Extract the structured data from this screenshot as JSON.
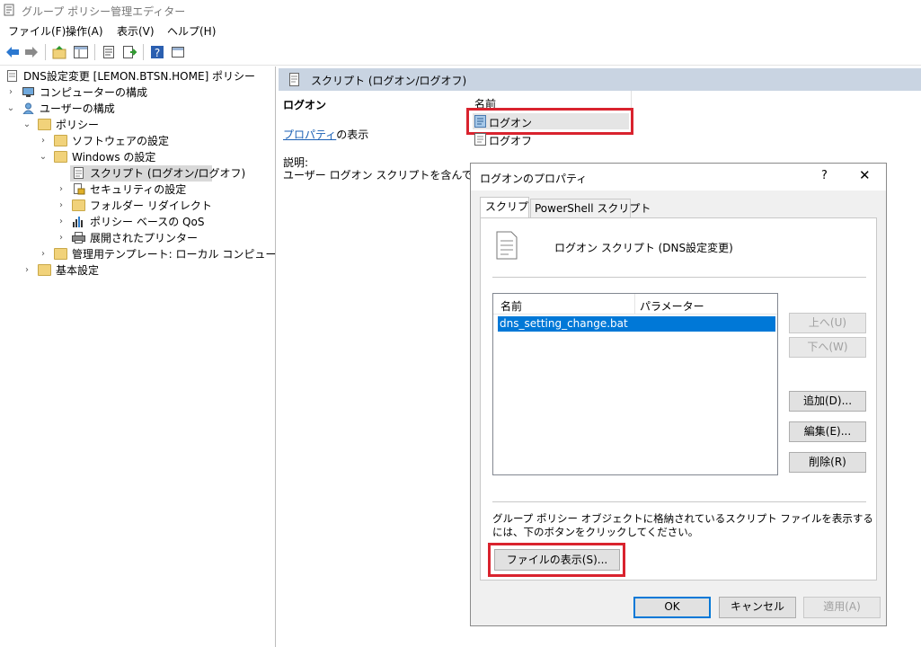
{
  "window": {
    "title": "グループ ポリシー管理エディター"
  },
  "menu": [
    "ファイル(F)",
    "操作(A)",
    "表示(V)",
    "ヘルプ(H)"
  ],
  "toolbar": [
    "back-icon",
    "forward-icon",
    "up-folder-icon",
    "show-hide-tree-icon",
    "properties-icon",
    "export-list-icon",
    "help-icon",
    "console-icon"
  ],
  "tree": {
    "root": "DNS設定変更 [LEMON.BTSN.HOME] ポリシー",
    "items": [
      "コンピューターの構成",
      "ユーザーの構成",
      "ポリシー",
      "ソフトウェアの設定",
      "Windows の設定",
      "スクリプト (ログオン/ログオフ)",
      "セキュリティの設定",
      "フォルダー リダイレクト",
      "ポリシー ベースの QoS",
      "展開されたプリンター",
      "管理用テンプレート: ローカル コンピューターから取",
      "基本設定"
    ]
  },
  "right": {
    "header_title": "スクリプト (ログオン/ログオフ)",
    "section_title": "ログオン",
    "properties_link": "プロパティ",
    "properties_suffix": "の表示",
    "description_label": "説明:",
    "description_text": "ユーザー ログオン スクリプトを含んでいます。",
    "list_header": "名前",
    "list_items": [
      "ログオン",
      "ログオフ"
    ]
  },
  "dialog": {
    "title": "ログオンのプロパティ",
    "help": "?",
    "close": "✕",
    "tabs": [
      "スクリプト",
      "PowerShell スクリプト"
    ],
    "heading": "ログオン スクリプト (DNS設定変更)",
    "columns": [
      "名前",
      "パラメーター"
    ],
    "rows": [
      {
        "name": "dns_setting_change.bat",
        "params": ""
      }
    ],
    "buttons": {
      "up": "上へ(U)",
      "down": "下へ(W)",
      "add": "追加(D)...",
      "edit": "編集(E)...",
      "remove": "削除(R)"
    },
    "note_line1": "グループ ポリシー オブジェクトに格納されているスクリプト ファイルを表示する",
    "note_line2": "には、下のボタンをクリックしてください。",
    "show_files": "ファイルの表示(S)...",
    "ok": "OK",
    "cancel": "キャンセル",
    "apply": "適用(A)"
  },
  "colors": {
    "highlight": "#d9232e",
    "selection": "#0078d7",
    "header_band": "#c9d4e2",
    "tree_selected": "#cce4f7"
  }
}
